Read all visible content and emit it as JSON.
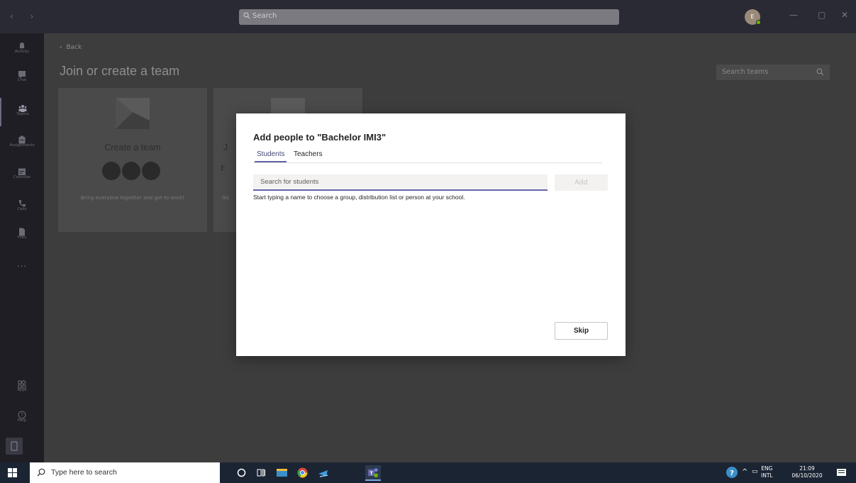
{
  "titlebar": {
    "search_placeholder": "Search",
    "avatar_initial": "E"
  },
  "rail": {
    "items": [
      {
        "label": "Activity"
      },
      {
        "label": "Chat"
      },
      {
        "label": "Teams"
      },
      {
        "label": "Assignments"
      },
      {
        "label": "Calendar"
      },
      {
        "label": "Calls"
      },
      {
        "label": "Files"
      },
      {
        "label": "..."
      },
      {
        "label": "Apps"
      },
      {
        "label": "Help"
      }
    ]
  },
  "main": {
    "back_label": "Back",
    "title": "Join or create a team",
    "search_teams_placeholder": "Search teams",
    "card1": {
      "title": "Create a team",
      "desc": "Bring everyone together and get to work!"
    },
    "card2": {
      "title_peek": "J",
      "code_peek": "E",
      "desc_peek": "Go"
    }
  },
  "modal": {
    "title": "Add people to \"Bachelor IMI3\"",
    "tabs": [
      "Students",
      "Teachers"
    ],
    "search_placeholder": "Search for students",
    "add_label": "Add",
    "hint": "Start typing a name to choose a group, distribution list or person at your school.",
    "skip_label": "Skip"
  },
  "taskbar": {
    "search_placeholder": "Type here to search",
    "lang_top": "ENG",
    "lang_bottom": "INTL",
    "time": "21:09",
    "date": "06/10/2020"
  },
  "colors": {
    "accent": "#6264a7",
    "taskbar": "#1b2433"
  }
}
